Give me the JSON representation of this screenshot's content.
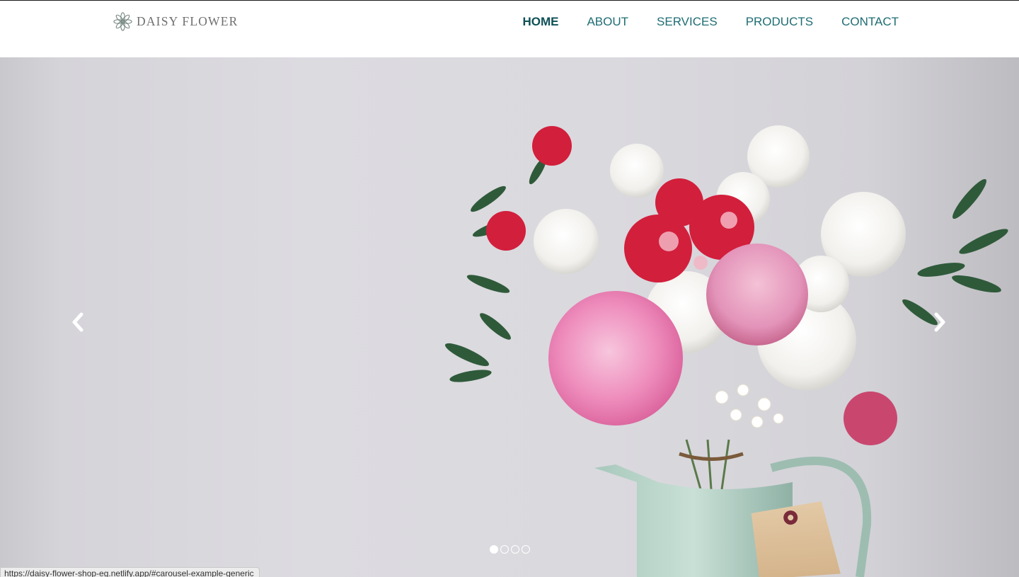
{
  "brand": {
    "name": "DAISY FLOWER",
    "logo_icon": "daisy-ornament-icon"
  },
  "nav": {
    "items": [
      {
        "label": "HOME",
        "active": true
      },
      {
        "label": "ABOUT",
        "active": false
      },
      {
        "label": "SERVICES",
        "active": false
      },
      {
        "label": "PRODUCTS",
        "active": false
      },
      {
        "label": "CONTACT",
        "active": false
      }
    ]
  },
  "carousel": {
    "slide_count": 4,
    "active_index": 0,
    "prev_icon": "chevron-left-icon",
    "next_icon": "chevron-right-icon",
    "slide_image": "flower bouquet in mint watering can"
  },
  "status_bar": {
    "url": "https://daisy-flower-shop-eg.netlify.app/#carousel-example-generic"
  },
  "colors": {
    "nav_text": "#1e6d73",
    "nav_active": "#0e5057",
    "hero_background": "#dadadf",
    "brand_text": "#6f6f6f"
  }
}
